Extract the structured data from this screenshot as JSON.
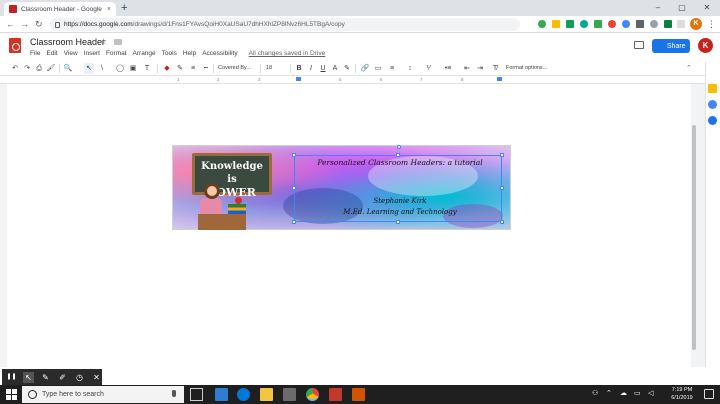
{
  "browser": {
    "tab_title": "Classroom Header - Google Dra",
    "tab_close": "×",
    "new_tab": "+",
    "url_domain": "https://docs.google.com",
    "url_path": "/drawings/d/1Fns1FYAvsQoiH0XaUSaU7dhHXhlZP8lNvz6HL5TBgA/copy",
    "back": "←",
    "forward": "→",
    "reload": "↻",
    "minimize": "–",
    "maximize": "▢",
    "close": "✕",
    "profile_initial": "K",
    "menu": "⋮"
  },
  "doc": {
    "title": "Classroom Header",
    "star": "☆",
    "menus": [
      "File",
      "Edit",
      "View",
      "Insert",
      "Format",
      "Arrange",
      "Tools",
      "Help",
      "Accessibility"
    ],
    "saved_status": "All changes saved in Drive",
    "share_label": "Share",
    "share_icon": "👤",
    "user_initial": "K"
  },
  "toolbar": {
    "undo": "↶",
    "redo": "↷",
    "print": "⎙",
    "paint": "🖌",
    "zoom": "🔍",
    "select": "↖",
    "line": "\\",
    "shape": "◯",
    "image": "▣",
    "textbox": "T",
    "font": "Covered By...",
    "font_size": "18",
    "bold": "B",
    "italic": "I",
    "underline": "U",
    "text_color": "A",
    "highlight": "✎",
    "link": "🔗",
    "comment": "▭",
    "align": "≡",
    "line_spacing": "↕",
    "numbered": "⅟",
    "bulleted": "•≡",
    "indent_less": "⇤",
    "indent_more": "⇥",
    "clear": "T̸",
    "format_options": "Format options...",
    "collapse": "⌃"
  },
  "ruler": {
    "numbers": [
      "1",
      "2",
      "3",
      "4",
      "5",
      "6",
      "7",
      "8"
    ]
  },
  "drawing": {
    "board_line1": "Knowledge is",
    "board_line2": "POWER",
    "title": "Personalized Classroom Headers: a tutorial",
    "name": "Stephanie Kirk",
    "degree": "M.Ed. Learning and Technology"
  },
  "recorder": {
    "pause": "❚❚",
    "pointer": "↖",
    "pen": "✎",
    "highlighter": "✐",
    "timer": "◷",
    "close": "✕"
  },
  "taskbar": {
    "search_placeholder": "Type here to search",
    "time": "7:19 PM",
    "date": "6/1/2019"
  },
  "colors": {
    "share_blue": "#1a73e8",
    "brand_red": "#d93025",
    "selection_blue": "#4285f4"
  }
}
